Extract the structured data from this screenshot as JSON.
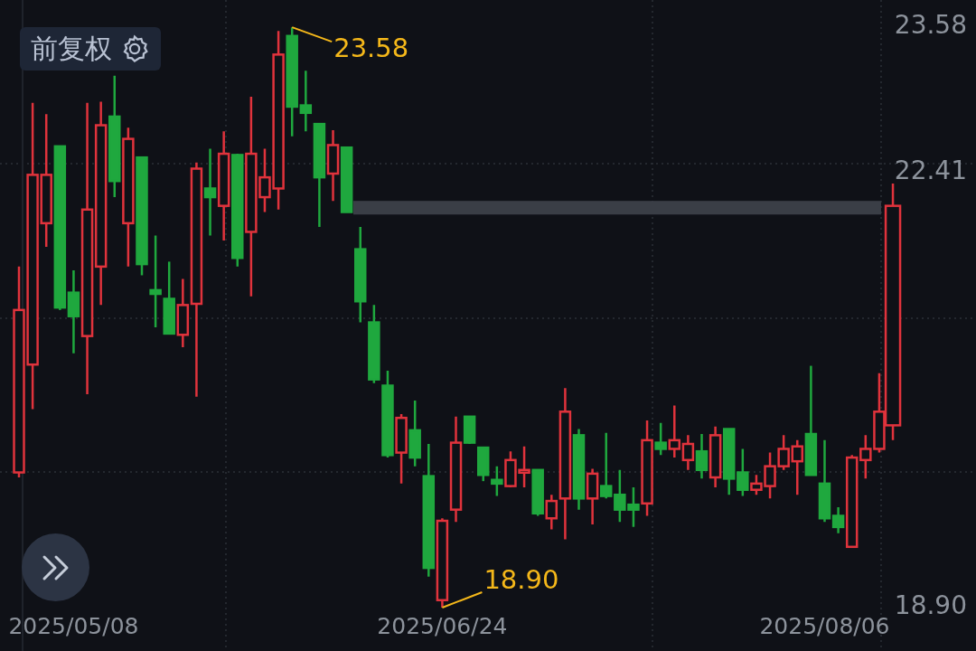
{
  "adjust_button": {
    "label": "前复权"
  },
  "chart_data": {
    "type": "candlestick",
    "categories": [
      null,
      null,
      null,
      null,
      "2025/05/08",
      null,
      null,
      null,
      null,
      null,
      null,
      null,
      null,
      null,
      null,
      null,
      null,
      null,
      null,
      null,
      null,
      null,
      null,
      null,
      null,
      null,
      null,
      null,
      null,
      null,
      null,
      "2025/06/24",
      null,
      null,
      null,
      null,
      null,
      null,
      null,
      null,
      null,
      null,
      null,
      null,
      null,
      null,
      null,
      null,
      null,
      null,
      null,
      null,
      null,
      null,
      null,
      null,
      null,
      null,
      null,
      "2025/08/06",
      null,
      null,
      null,
      null,
      null
    ],
    "ohlc": [
      [
        19.99,
        21.65,
        19.95,
        21.3
      ],
      [
        20.86,
        22.97,
        20.5,
        22.39
      ],
      [
        22.0,
        22.88,
        21.81,
        22.39
      ],
      [
        22.62,
        22.62,
        21.3,
        21.32
      ],
      [
        21.44,
        21.62,
        20.95,
        21.25
      ],
      [
        21.09,
        22.97,
        20.62,
        22.11
      ],
      [
        21.65,
        22.98,
        21.34,
        22.79
      ],
      [
        22.86,
        23.19,
        22.21,
        22.34
      ],
      [
        22.0,
        22.77,
        21.65,
        22.68
      ],
      [
        22.53,
        22.53,
        21.58,
        21.67
      ],
      [
        21.46,
        21.9,
        21.16,
        21.43
      ],
      [
        21.39,
        21.69,
        21.11,
        21.11
      ],
      [
        21.1,
        21.55,
        21.0,
        21.34
      ],
      [
        21.35,
        22.49,
        20.6,
        22.44
      ],
      [
        22.28,
        22.6,
        21.9,
        22.21
      ],
      [
        22.14,
        22.74,
        21.86,
        22.56
      ],
      [
        22.55,
        22.56,
        21.65,
        21.72
      ],
      [
        21.93,
        23.02,
        21.41,
        22.56
      ],
      [
        22.21,
        22.6,
        22.09,
        22.37
      ],
      [
        22.28,
        23.55,
        22.11,
        23.36
      ],
      [
        23.51,
        23.58,
        22.7,
        22.94
      ],
      [
        22.95,
        23.23,
        22.74,
        22.89
      ],
      [
        22.8,
        22.8,
        21.97,
        22.37
      ],
      [
        22.4,
        22.75,
        22.18,
        22.63
      ],
      [
        22.61,
        22.61,
        22.09,
        22.09
      ],
      [
        21.79,
        21.97,
        21.2,
        21.37
      ],
      [
        21.2,
        21.34,
        20.71,
        20.74
      ],
      [
        20.69,
        20.81,
        20.11,
        20.13
      ],
      [
        20.15,
        20.46,
        19.9,
        20.43
      ],
      [
        20.33,
        20.57,
        20.04,
        20.11
      ],
      [
        19.96,
        20.22,
        19.15,
        19.22
      ],
      [
        18.96,
        19.62,
        18.9,
        19.6
      ],
      [
        19.69,
        20.44,
        19.59,
        20.23
      ],
      [
        20.44,
        20.44,
        20.22,
        20.23
      ],
      [
        20.19,
        20.19,
        19.92,
        19.97
      ],
      [
        19.93,
        20.04,
        19.8,
        19.9
      ],
      [
        19.88,
        20.16,
        19.87,
        20.09
      ],
      [
        19.99,
        20.2,
        19.87,
        20.01
      ],
      [
        20.01,
        20.01,
        19.64,
        19.66
      ],
      [
        19.62,
        19.81,
        19.53,
        19.76
      ],
      [
        19.78,
        20.67,
        19.45,
        20.48
      ],
      [
        20.29,
        20.34,
        19.69,
        19.78
      ],
      [
        19.78,
        20.02,
        19.57,
        19.98
      ],
      [
        19.88,
        20.31,
        19.78,
        19.8
      ],
      [
        19.81,
        20.01,
        19.59,
        19.69
      ],
      [
        19.73,
        19.87,
        19.55,
        19.69
      ],
      [
        19.74,
        20.41,
        19.64,
        20.25
      ],
      [
        20.23,
        20.39,
        20.13,
        20.18
      ],
      [
        20.18,
        20.53,
        20.11,
        20.25
      ],
      [
        20.09,
        20.29,
        20.01,
        20.22
      ],
      [
        20.16,
        20.3,
        19.94,
        20.01
      ],
      [
        19.95,
        20.36,
        19.87,
        20.29
      ],
      [
        20.34,
        20.34,
        19.81,
        19.94
      ],
      [
        19.99,
        20.18,
        19.8,
        19.85
      ],
      [
        19.85,
        19.97,
        19.81,
        19.9
      ],
      [
        19.88,
        20.15,
        19.78,
        20.04
      ],
      [
        20.04,
        20.29,
        20.01,
        20.18
      ],
      [
        20.08,
        20.25,
        19.81,
        20.2
      ],
      [
        20.3,
        20.85,
        19.97,
        19.97
      ],
      [
        19.9,
        20.25,
        19.59,
        19.62
      ],
      [
        19.64,
        19.71,
        19.5,
        19.55
      ],
      [
        19.39,
        20.13,
        19.39,
        20.11
      ],
      [
        20.09,
        20.29,
        19.94,
        20.18
      ],
      [
        20.18,
        20.79,
        20.15,
        20.48
      ],
      [
        20.37,
        22.32,
        20.25,
        22.14
      ]
    ],
    "ylim": [
      18.55,
      23.8
    ],
    "bands": [
      {
        "axis": "y",
        "from": 22.07,
        "to": 22.18,
        "color": "#3a3e46"
      }
    ],
    "yticks": [
      {
        "value": 23.58,
        "label": "23.58"
      },
      {
        "value": 22.41,
        "label": "22.41"
      },
      {
        "value": 18.9,
        "label": "18.90"
      }
    ],
    "annotations": [
      "23.58",
      "18.90"
    ]
  }
}
